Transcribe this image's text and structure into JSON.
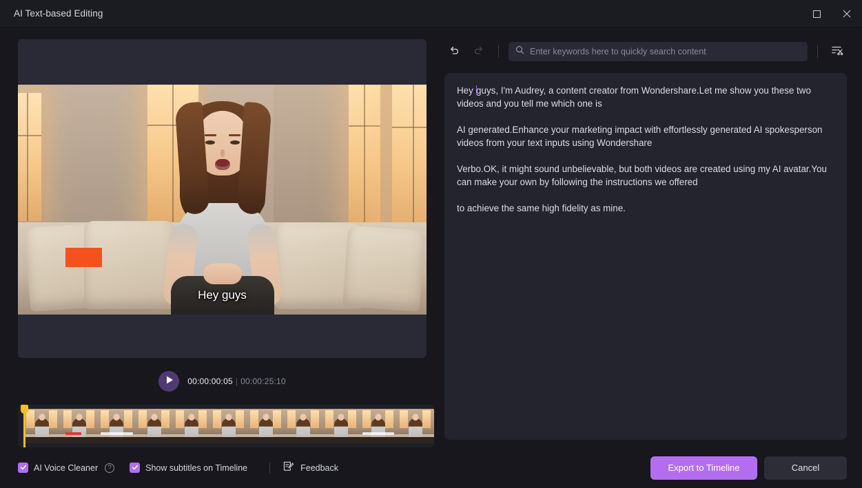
{
  "window": {
    "title": "AI Text-based Editing",
    "controls": [
      {
        "name": "maximize",
        "icon": "maximize-icon"
      },
      {
        "name": "close",
        "icon": "close-icon"
      }
    ]
  },
  "preview": {
    "subtitle": "Hey guys",
    "transport": {
      "play_icon": "play-icon",
      "current_time": "00:00:00:05",
      "separator": "|",
      "total_time": "00:00:25:10"
    },
    "timeline": {
      "thumbnail_count": 11,
      "playhead_color": "#f2c020"
    }
  },
  "toolbar": {
    "undo_icon": "undo-icon",
    "redo_icon": "redo-icon",
    "search": {
      "icon": "search-icon",
      "value": "",
      "placeholder": "Enter keywords here to quickly search content"
    },
    "remove_filler_icon": "text-scissors-icon"
  },
  "transcript": {
    "paragraphs": [
      {
        "pre_caret": "Hey ",
        "post_caret": "guys, I'm Audrey, a content creator from Wondershare.Let me show you these two videos and you tell me which one is"
      },
      {
        "text": " AI generated.Enhance your marketing impact with effortlessly generated AI spokesperson videos from your text inputs using Wondershare"
      },
      {
        "text": " Verbo.OK, it might sound unbelievable, but both videos are created using my AI avatar.You can make your own by following the instructions we offered"
      },
      {
        "text": " to achieve the same high fidelity as mine."
      }
    ]
  },
  "footer": {
    "ai_voice_cleaner": {
      "label": "AI Voice Cleaner",
      "checked": true,
      "help_icon": "help-circle-icon",
      "help_glyph": "?"
    },
    "show_subtitles": {
      "label": "Show subtitles on Timeline",
      "checked": true
    },
    "feedback": {
      "label": "Feedback",
      "icon": "document-edit-icon"
    },
    "export_button": "Export to Timeline",
    "cancel_button": "Cancel"
  },
  "colors": {
    "accent": "#b36ef0",
    "window_bg": "#17171d",
    "titlebar_bg": "#1b1b22",
    "panel_bg": "#24242e",
    "playhead": "#f2c020",
    "overlay_box": "#f4511e",
    "caret": "#9b5cf0"
  }
}
